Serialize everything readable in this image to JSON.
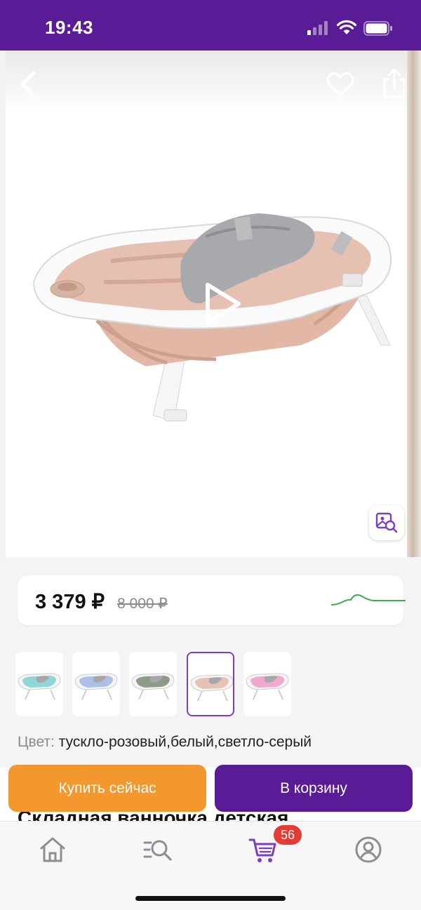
{
  "status_bar": {
    "time": "19:43"
  },
  "product": {
    "price": "3 379 ₽",
    "old_price": "8 000 ₽",
    "color_label": "Цвет:",
    "color_value": "тускло-розовый,белый,светло-серый",
    "title_partial": "Складная ванночка детская"
  },
  "swatches": [
    {
      "name": "teal",
      "color": "#8fd6d6",
      "selected": false
    },
    {
      "name": "blue",
      "color": "#aebfe8",
      "selected": false
    },
    {
      "name": "green",
      "color": "#8f9b8a",
      "selected": false
    },
    {
      "name": "pink",
      "color": "#e7c2b4",
      "selected": true
    },
    {
      "name": "rose",
      "color": "#f0a8cc",
      "selected": false
    }
  ],
  "actions": {
    "buy_now": "Купить сейчас",
    "add_to_cart": "В корзину"
  },
  "tabbar": {
    "cart_badge": "56"
  },
  "colors": {
    "brand": "#5a1b97",
    "accent": "#f3982f",
    "badge": "#e53b35",
    "price_trend": "#3fae4a"
  },
  "icons": [
    "back-icon",
    "heart-icon",
    "share-icon",
    "play-icon",
    "image-search-icon",
    "home-icon",
    "catalog-search-icon",
    "cart-icon",
    "profile-icon"
  ]
}
